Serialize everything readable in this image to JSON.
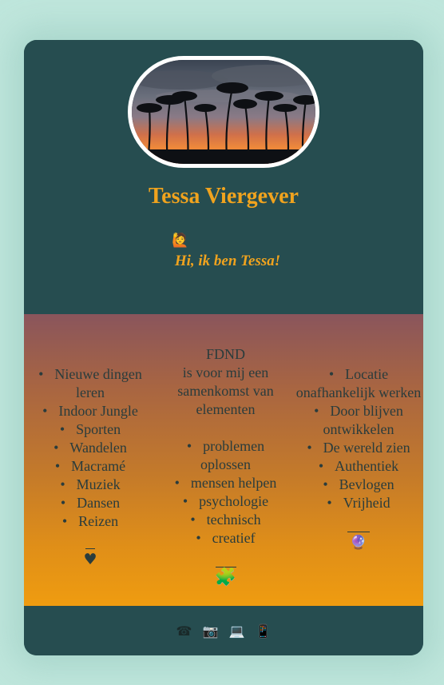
{
  "profile": {
    "name": "Tessa Viergever",
    "wave_emoji": "🙋",
    "greeting": "Hi, ik ben Tessa!"
  },
  "columns": {
    "left": {
      "items": [
        "Nieuwe dingen leren",
        "Indoor Jungle",
        "Sporten",
        "Wandelen",
        "Macramé",
        "Muziek",
        "Dansen",
        "Reizen"
      ],
      "symbol": "♥"
    },
    "middle": {
      "intro_title": "FDND",
      "intro_text": "is voor mij een samenkomst van elementen",
      "items": [
        "problemen oplossen",
        "mensen helpen",
        "psychologie",
        "technisch",
        "creatief"
      ],
      "symbol": "🧩"
    },
    "right": {
      "items": [
        "Locatie onafhankelijk werken",
        "Door blijven ontwikkelen",
        "De wereld zien",
        "Authentiek",
        "Bevlogen",
        "Vrijheid"
      ],
      "symbol": "🔮"
    }
  },
  "footer": {
    "icons": [
      "phone-icon",
      "camera-icon",
      "laptop-icon",
      "tablet-icon"
    ],
    "glyphs": [
      "☎",
      "📷",
      "💻",
      "📱"
    ]
  },
  "colors": {
    "card": "#264d50",
    "accent": "#f0a31e",
    "page_background": "#bfe6dc",
    "gradient_top": "#8a555c",
    "gradient_bottom": "#ef9c10"
  }
}
